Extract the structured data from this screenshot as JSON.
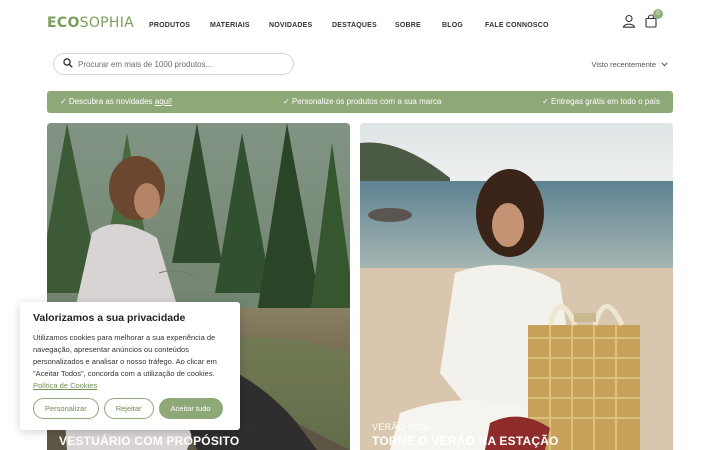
{
  "header": {
    "logo_bold": "ECO",
    "logo_light": "SOPHIA",
    "nav": [
      "PRODUTOS",
      "MATERIAIS",
      "NOVIDADES",
      "DESTAQUES",
      "SOBRE",
      "BLOG",
      "FALE CONNOSCO"
    ],
    "cart_count": "0",
    "icons": [
      "user-icon",
      "shopping-bag-icon"
    ]
  },
  "search": {
    "placeholder": "Procurar em mais de 1000 produtos..."
  },
  "recently_viewed": {
    "label": "Visto recentemente"
  },
  "promo": {
    "item1_text": "✓ Descubra as novidades ",
    "item1_link": "aqui!",
    "item2_text": "✓ Personalize os produtos com a sua marca",
    "item3_text": "✓ Entregas grátis em todo o país"
  },
  "cards": [
    {
      "eyebrow": "",
      "headline": "VESTUÁRIO COM PROPÓSITO"
    },
    {
      "eyebrow": "VERÃO 2026",
      "headline": "TORNE O VERÃO NA ESTAÇÃO"
    }
  ],
  "cookie": {
    "title": "Valorizamos a sua privacidade",
    "body": "Utilizamos cookies para melhorar a sua experiência de navegação, apresentar anúncios ou conteúdos personalizados e analisar o nosso tráfego. Ao clicar em \"Aceitar Todos\", concorda com a utilização de cookies. ",
    "policy_link": "Política de Cookies",
    "customize_label": "Personalizar",
    "reject_label": "Rejeitar",
    "accept_label": "Aceitar tudo"
  },
  "colors": {
    "brand_green": "#8fa878",
    "logo_green": "#7a9e5c"
  }
}
